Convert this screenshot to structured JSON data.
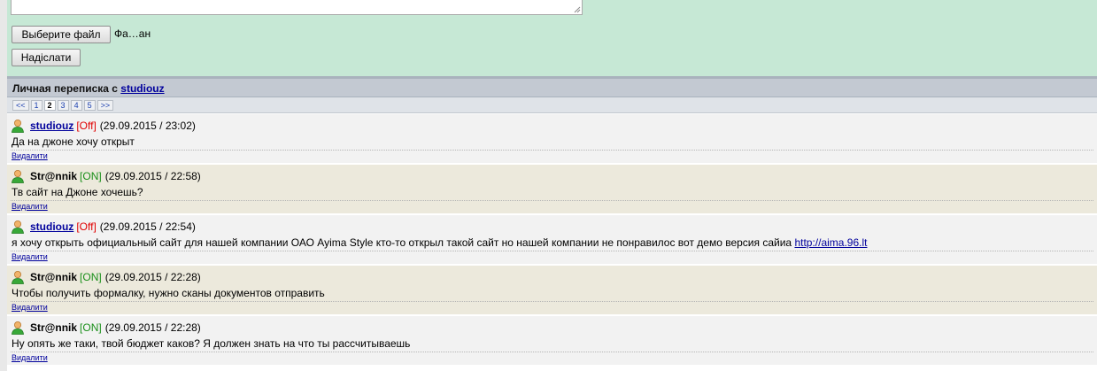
{
  "form": {
    "file_button_label": "Выберите файл",
    "file_name": "Фа…ан",
    "send_button_label": "Надіслати"
  },
  "conversation": {
    "title_prefix": "Личная переписка с",
    "partner": "studiouz"
  },
  "pager": {
    "items": [
      {
        "label": "<<",
        "current": false
      },
      {
        "label": "1",
        "current": false
      },
      {
        "label": "2",
        "current": true
      },
      {
        "label": "3",
        "current": false
      },
      {
        "label": "4",
        "current": false
      },
      {
        "label": "5",
        "current": false
      },
      {
        "label": ">>",
        "current": false
      }
    ]
  },
  "delete_label": "Видалити",
  "messages": [
    {
      "author": "studiouz",
      "author_is_link": true,
      "status": "[Off]",
      "online": false,
      "date": "(29.09.2015 / 23:02)",
      "text": "Да на джоне хочу открыт",
      "link": ""
    },
    {
      "author": "Str@nnik",
      "author_is_link": false,
      "status": "[ON]",
      "online": true,
      "date": "(29.09.2015 / 22:58)",
      "text": "Тв сайт на Джоне хочешь?",
      "link": ""
    },
    {
      "author": "studiouz",
      "author_is_link": true,
      "status": "[Off]",
      "online": false,
      "date": "(29.09.2015 / 22:54)",
      "text": "я хочу открыть официальный сайт для нашей компании ОАО Ayima Style кто-то открыл такой сайт но нашей компании не понравилос вот демо версия сайиа",
      "link": "http://aima.96.lt"
    },
    {
      "author": "Str@nnik",
      "author_is_link": false,
      "status": "[ON]",
      "online": true,
      "date": "(29.09.2015 / 22:28)",
      "text": "Чтобы получить формалку, нужно сканы документов отправить",
      "link": ""
    },
    {
      "author": "Str@nnik",
      "author_is_link": false,
      "status": "[ON]",
      "online": true,
      "date": "(29.09.2015 / 22:28)",
      "text": "Ну опять же таки, твой бюджет каков? Я должен знать на что ты рассчитываешь",
      "link": ""
    }
  ],
  "colors": {
    "form_bg": "#c6e8d5",
    "header_bg": "#c3c9d2",
    "link": "#00009c",
    "status_off": "#e00000",
    "status_on": "#1a8f1a",
    "row_even": "#f2f2f2",
    "row_odd": "#ece9dc"
  },
  "icons": {
    "user": "user-icon",
    "resize": "resize-grip-icon"
  }
}
